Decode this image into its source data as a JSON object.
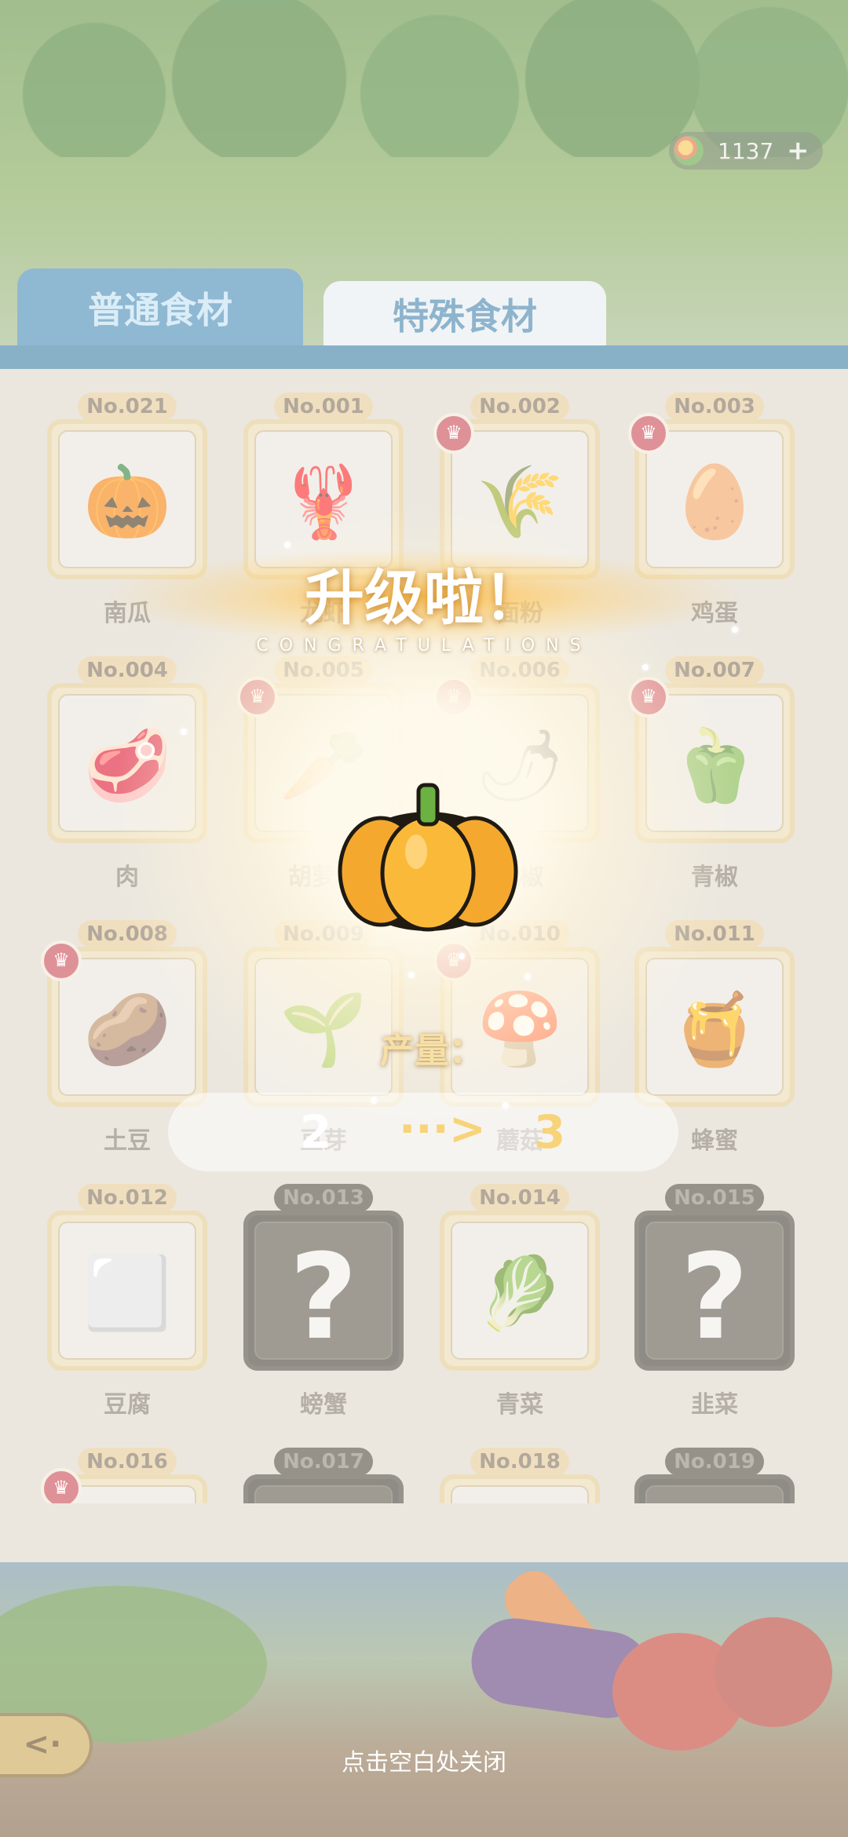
{
  "currency": {
    "value": "1137",
    "plus_label": "+"
  },
  "tabs": [
    {
      "label": "普通食材"
    },
    {
      "label": "特殊食材"
    }
  ],
  "cells": [
    {
      "no": "No.021",
      "name": "南瓜",
      "icon": "🎃",
      "special": false,
      "locked": false
    },
    {
      "no": "No.001",
      "name": "龙虾",
      "icon": "🦞",
      "special": false,
      "locked": false
    },
    {
      "no": "No.002",
      "name": "面粉",
      "icon": "🌾",
      "special": true,
      "locked": false
    },
    {
      "no": "No.003",
      "name": "鸡蛋",
      "icon": "🥚",
      "special": true,
      "locked": false
    },
    {
      "no": "No.004",
      "name": "肉",
      "icon": "🥩",
      "special": false,
      "locked": false
    },
    {
      "no": "No.005",
      "name": "胡萝卜",
      "icon": "🥕",
      "special": true,
      "locked": false
    },
    {
      "no": "No.006",
      "name": "辣椒",
      "icon": "🌶",
      "special": true,
      "locked": false
    },
    {
      "no": "No.007",
      "name": "青椒",
      "icon": "🫑",
      "special": true,
      "locked": false
    },
    {
      "no": "No.008",
      "name": "土豆",
      "icon": "🥔",
      "special": true,
      "locked": false
    },
    {
      "no": "No.009",
      "name": "豆芽",
      "icon": "🌱",
      "special": false,
      "locked": false
    },
    {
      "no": "No.010",
      "name": "蘑菇",
      "icon": "🍄",
      "special": true,
      "locked": false
    },
    {
      "no": "No.011",
      "name": "蜂蜜",
      "icon": "🍯",
      "special": false,
      "locked": false
    },
    {
      "no": "No.012",
      "name": "豆腐",
      "icon": "⬜",
      "special": false,
      "locked": false
    },
    {
      "no": "No.013",
      "name": "螃蟹",
      "icon": "?",
      "special": false,
      "locked": true
    },
    {
      "no": "No.014",
      "name": "青菜",
      "icon": "🥬",
      "special": false,
      "locked": false
    },
    {
      "no": "No.015",
      "name": "韭菜",
      "icon": "?",
      "special": false,
      "locked": true
    },
    {
      "no": "No.016",
      "name": "",
      "icon": "",
      "special": true,
      "locked": false
    },
    {
      "no": "No.017",
      "name": "",
      "icon": "",
      "special": false,
      "locked": true
    },
    {
      "no": "No.018",
      "name": "",
      "icon": "",
      "special": false,
      "locked": false
    },
    {
      "no": "No.019",
      "name": "",
      "icon": "",
      "special": false,
      "locked": true
    }
  ],
  "levelup": {
    "title": "升级啦！",
    "subtitle": "CONGRATULATIONS",
    "yield_label": "产量：",
    "from": "2",
    "arrow": "···>",
    "to": "3"
  },
  "hint": "点击空白处关闭",
  "colors": {
    "tab_active": "#3e86b2",
    "accent": "#f7d37a",
    "locked": "#3e3a30"
  }
}
